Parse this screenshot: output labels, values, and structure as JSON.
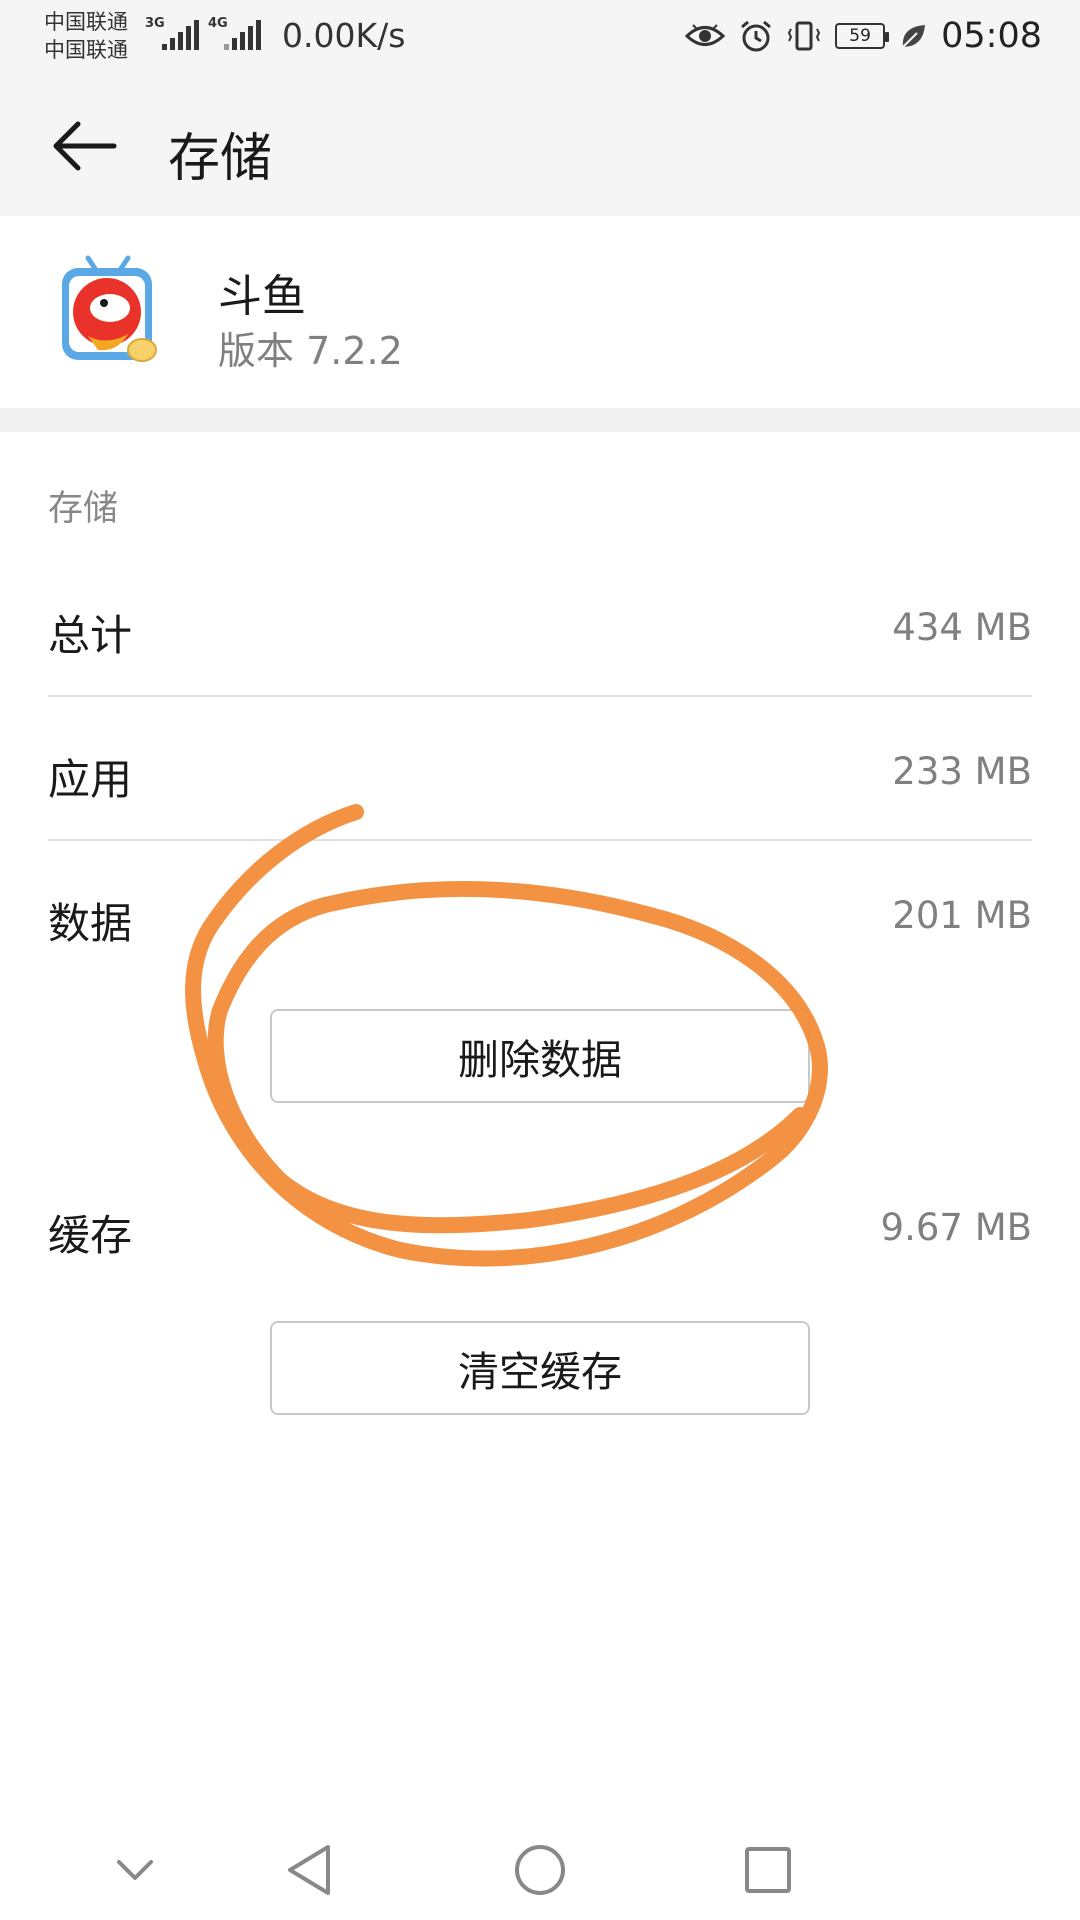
{
  "status_bar": {
    "carrier_1": "中国联通",
    "carrier_2": "中国联通",
    "network_1": "3G",
    "network_2": "4G",
    "speed": "0.00K/s",
    "battery": "59",
    "time": "05:08"
  },
  "title_bar": {
    "title": "存储"
  },
  "app": {
    "name": "斗鱼",
    "version": "版本 7.2.2"
  },
  "storage": {
    "section_header": "存储",
    "total": {
      "label": "总计",
      "value": "434 MB"
    },
    "app": {
      "label": "应用",
      "value": "233 MB"
    },
    "data": {
      "label": "数据",
      "value": "201 MB"
    },
    "delete_data_button": "删除数据",
    "cache": {
      "label": "缓存",
      "value": "9.67 MB"
    },
    "clear_cache_button": "清空缓存"
  },
  "colors": {
    "annotation_stroke": "#f28c38",
    "secondary_text": "#808080",
    "app_icon_red": "#e8322a",
    "app_icon_frame": "#5aa9e6"
  },
  "icons": {
    "back": "arrow-left-icon",
    "eye": "eye-icon",
    "alarm": "alarm-icon",
    "vibrate": "vibrate-icon",
    "leaf": "leaf-icon",
    "nav_collapse": "chevron-down-icon",
    "nav_back": "triangle-back-icon",
    "nav_home": "circle-home-icon",
    "nav_recent": "square-recent-icon"
  }
}
